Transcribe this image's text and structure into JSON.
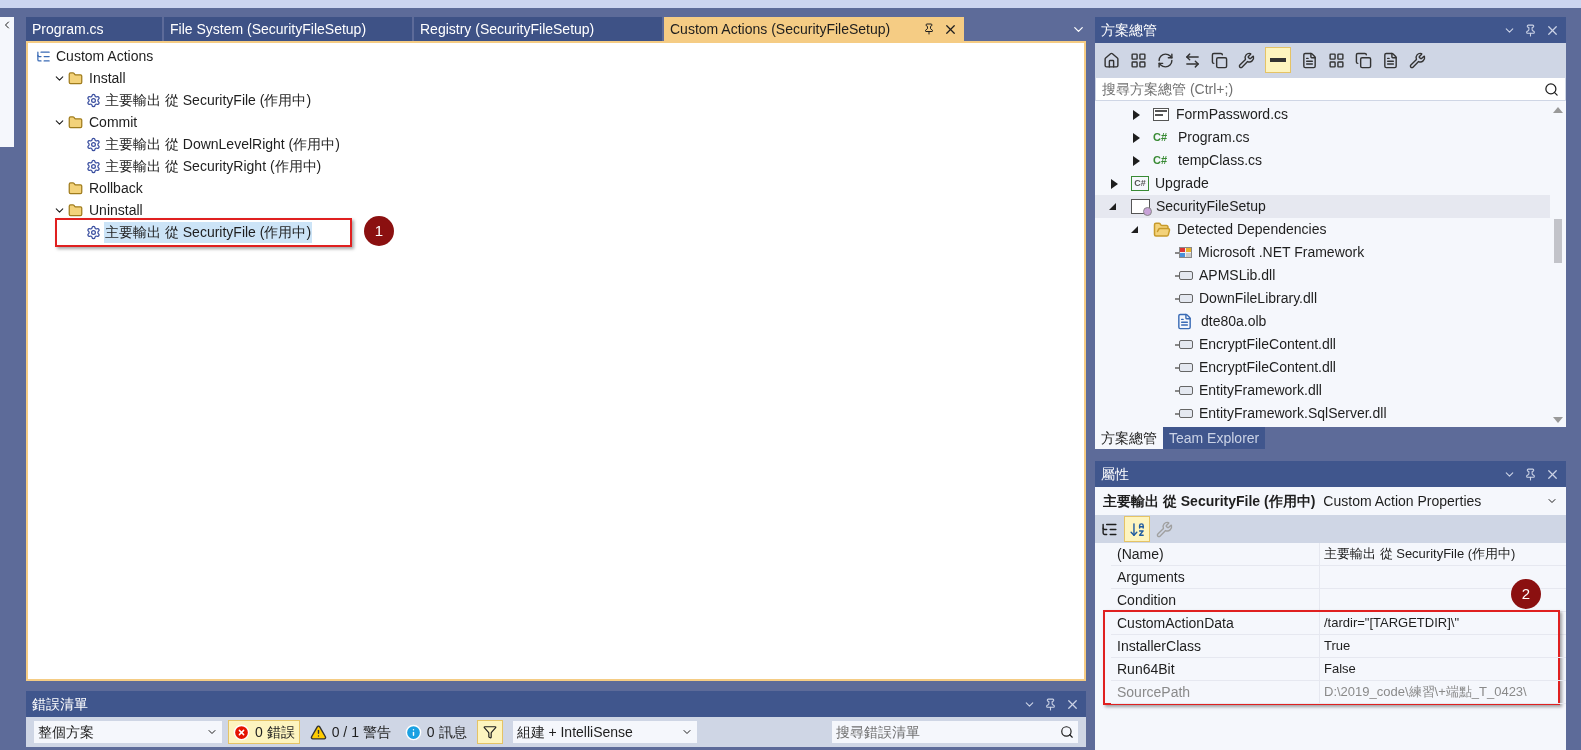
{
  "document_tabs": [
    {
      "label": "Program.cs",
      "selected": false
    },
    {
      "label": "File System (SecurityFileSetup)",
      "selected": false
    },
    {
      "label": "Registry (SecurityFileSetup)",
      "selected": false
    },
    {
      "label": "Custom Actions (SecurityFileSetup)",
      "selected": true
    }
  ],
  "custom_actions": {
    "tree": [
      {
        "label": "Custom Actions",
        "kind": "root",
        "selected": false,
        "children": [
          {
            "label": "Install",
            "kind": "folder",
            "expanded": true,
            "selected": false,
            "children": [
              {
                "label": "主要輸出 從 SecurityFile (作用中)",
                "kind": "output",
                "selected": false
              }
            ]
          },
          {
            "label": "Commit",
            "kind": "folder",
            "expanded": true,
            "selected": false,
            "children": [
              {
                "label": "主要輸出 從 DownLevelRight (作用中)",
                "kind": "output",
                "selected": false
              },
              {
                "label": "主要輸出 從 SecurityRight (作用中)",
                "kind": "output",
                "selected": false
              }
            ]
          },
          {
            "label": "Rollback",
            "kind": "folder",
            "selected": false
          },
          {
            "label": "Uninstall",
            "kind": "folder",
            "expanded": true,
            "selected": false,
            "children": [
              {
                "label": "主要輸出 從 SecurityFile (作用中)",
                "kind": "output",
                "selected": true,
                "callout": "1"
              }
            ]
          }
        ]
      }
    ]
  },
  "error_list": {
    "title": "錯誤清單",
    "scope": "整個方案",
    "filters": [
      {
        "kind": "error",
        "label": "0 錯誤",
        "selected": true
      },
      {
        "kind": "warning",
        "label": "0 / 1 警告",
        "selected": false
      },
      {
        "kind": "info",
        "label": "0 訊息",
        "selected": false
      }
    ],
    "filter_toggle": {
      "selected": true
    },
    "source": "組建 + IntelliSense",
    "search": {
      "placeholder": "搜尋錯誤清單"
    }
  },
  "solution_explorer": {
    "title": "方案總管",
    "search": {
      "placeholder": "搜尋方案總管 (Ctrl+;)"
    },
    "tree": [
      {
        "children": [
          {
            "label": "FormPassword.cs",
            "kind": "form",
            "expanded": false,
            "selected": false
          },
          {
            "label": "Program.cs",
            "kind": "csharp",
            "badge": "C#",
            "expanded": false,
            "selected": false
          },
          {
            "label": "tempClass.cs",
            "kind": "csharp",
            "badge": "C#",
            "expanded": false,
            "selected": false
          }
        ]
      },
      {
        "label": "Upgrade",
        "kind": "project",
        "badge": "C#",
        "expanded": false,
        "selected": false
      },
      {
        "label": "SecurityFileSetup",
        "kind": "setup",
        "expanded": true,
        "selected": true,
        "children": [
          {
            "label": "Detected Dependencies",
            "kind": "folder-open",
            "expanded": true,
            "selected": false,
            "children": [
              {
                "label": "Microsoft .NET Framework",
                "kind": "framework",
                "selected": false
              },
              {
                "label": "APMSLib.dll",
                "kind": "assembly",
                "selected": false
              },
              {
                "label": "DownFileLibrary.dll",
                "kind": "assembly",
                "selected": false
              },
              {
                "label": "dte80a.olb",
                "kind": "document",
                "selected": false
              },
              {
                "label": "EncryptFileContent.dll",
                "kind": "assembly",
                "selected": false
              },
              {
                "label": "EncryptFileContent.dll",
                "kind": "assembly",
                "selected": false
              },
              {
                "label": "EntityFramework.dll",
                "kind": "assembly",
                "selected": false
              },
              {
                "label": "EntityFramework.SqlServer.dll",
                "kind": "assembly",
                "selected": false
              }
            ]
          }
        ]
      }
    ],
    "bottom_tabs": [
      {
        "label": "方案總管",
        "selected": true
      },
      {
        "label": "Team Explorer",
        "selected": false
      }
    ]
  },
  "properties": {
    "title": "屬性",
    "object_name": "主要輸出 從 SecurityFile (作用中)",
    "object_type": "Custom Action Properties",
    "rows": [
      {
        "name": "(Name)",
        "value": "主要輸出 從 SecurityFile (作用中)",
        "disabled": false
      },
      {
        "name": "Arguments",
        "disabled": false
      },
      {
        "name": "Condition",
        "disabled": false
      },
      {
        "name": "CustomActionData",
        "value": "/tardir=\"[TARGETDIR]\\\"",
        "disabled": false,
        "callout": "2"
      },
      {
        "name": "InstallerClass",
        "value": "True",
        "disabled": false
      },
      {
        "name": "Run64Bit",
        "value": "False",
        "disabled": false
      },
      {
        "name": "SourcePath",
        "value": "D:\\2019_code\\練習\\+端點_T_0423\\",
        "disabled": true
      }
    ]
  }
}
